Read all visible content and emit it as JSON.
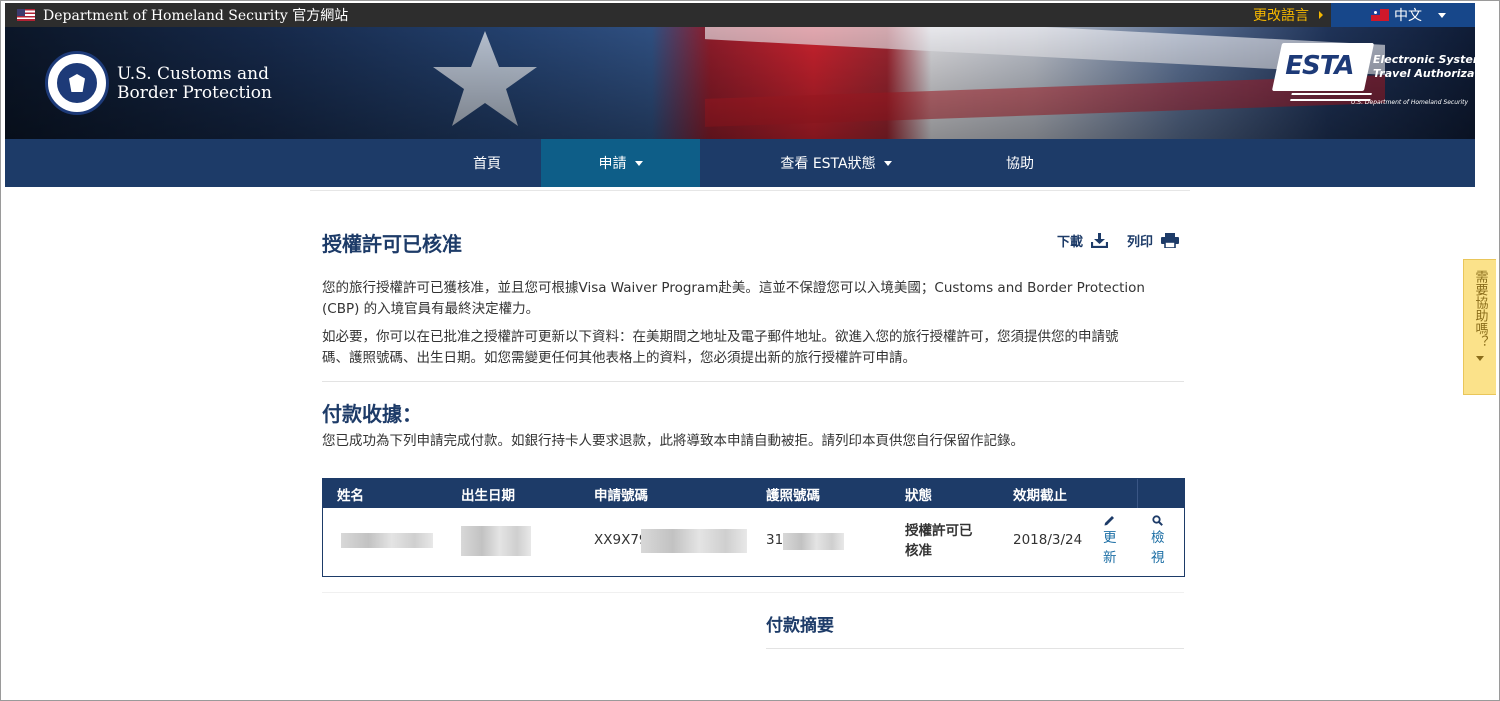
{
  "topbar": {
    "agency": "Department of Homeland Security 官方網站",
    "change_language": "更改語言",
    "language": "中文"
  },
  "header": {
    "agency_line1": "U.S. Customs and",
    "agency_line2": "Border Protection",
    "esta_logo_word": "ESTA",
    "esta_line1": "Electronic System for",
    "esta_line2": "Travel Authorization",
    "esta_sub": "U.S. Department of Homeland Security"
  },
  "nav": {
    "home": "首頁",
    "apply": "申請",
    "check_status": "查看 ESTA狀態",
    "help": "協助"
  },
  "main": {
    "title": "授權許可已核准",
    "download": "下載",
    "print": "列印",
    "para1_line1": "您的旅行授權許可已獲核准，並且您可根據Visa Waiver Program赴美。這並不保證您可以入境美國；Customs and Border Protection",
    "para1_line2": "(CBP) 的入境官員有最終決定權力。",
    "para2_line1": "如必要，你可以在已批准之授權許可更新以下資料：在美期間之地址及電子郵件地址。欲進入您的旅行授權許可，您須提供您的申請號",
    "para2_line2": "碼、護照號碼、出生日期。如您需變更任何其他表格上的資料，您必須提出新的旅行授權許可申請。",
    "receipt_title": "付款收據：",
    "receipt_text": "您已成功為下列申請完成付款。如銀行持卡人要求退款，此將導致本申請自動被拒。請列印本頁供您自行保留作記錄。",
    "summary_title": "付款摘要"
  },
  "table": {
    "headers": [
      "姓名",
      "出生日期",
      "申請號碼",
      "護照號碼",
      "狀態",
      "效期截止"
    ],
    "row": {
      "application_prefix": "XX9X79",
      "passport_prefix": "31",
      "status_line1": "授權許可已",
      "status_line2": "核准",
      "expiry": "2018/3/24",
      "update_line1": "更",
      "update_line2": "新",
      "view_line1": "檢",
      "view_line2": "視"
    }
  },
  "help_tab": {
    "label": "需要協助嗎？"
  },
  "colors": {
    "navy": "#1d3b68",
    "active_tab": "#0e5e88",
    "gold": "#f5b700",
    "link_blue": "#1d6fa5"
  },
  "icons": [
    "us-flag-icon",
    "tw-flag-icon",
    "dhs-seal-icon",
    "download-icon",
    "print-icon",
    "pencil-icon",
    "magnifier-icon"
  ]
}
